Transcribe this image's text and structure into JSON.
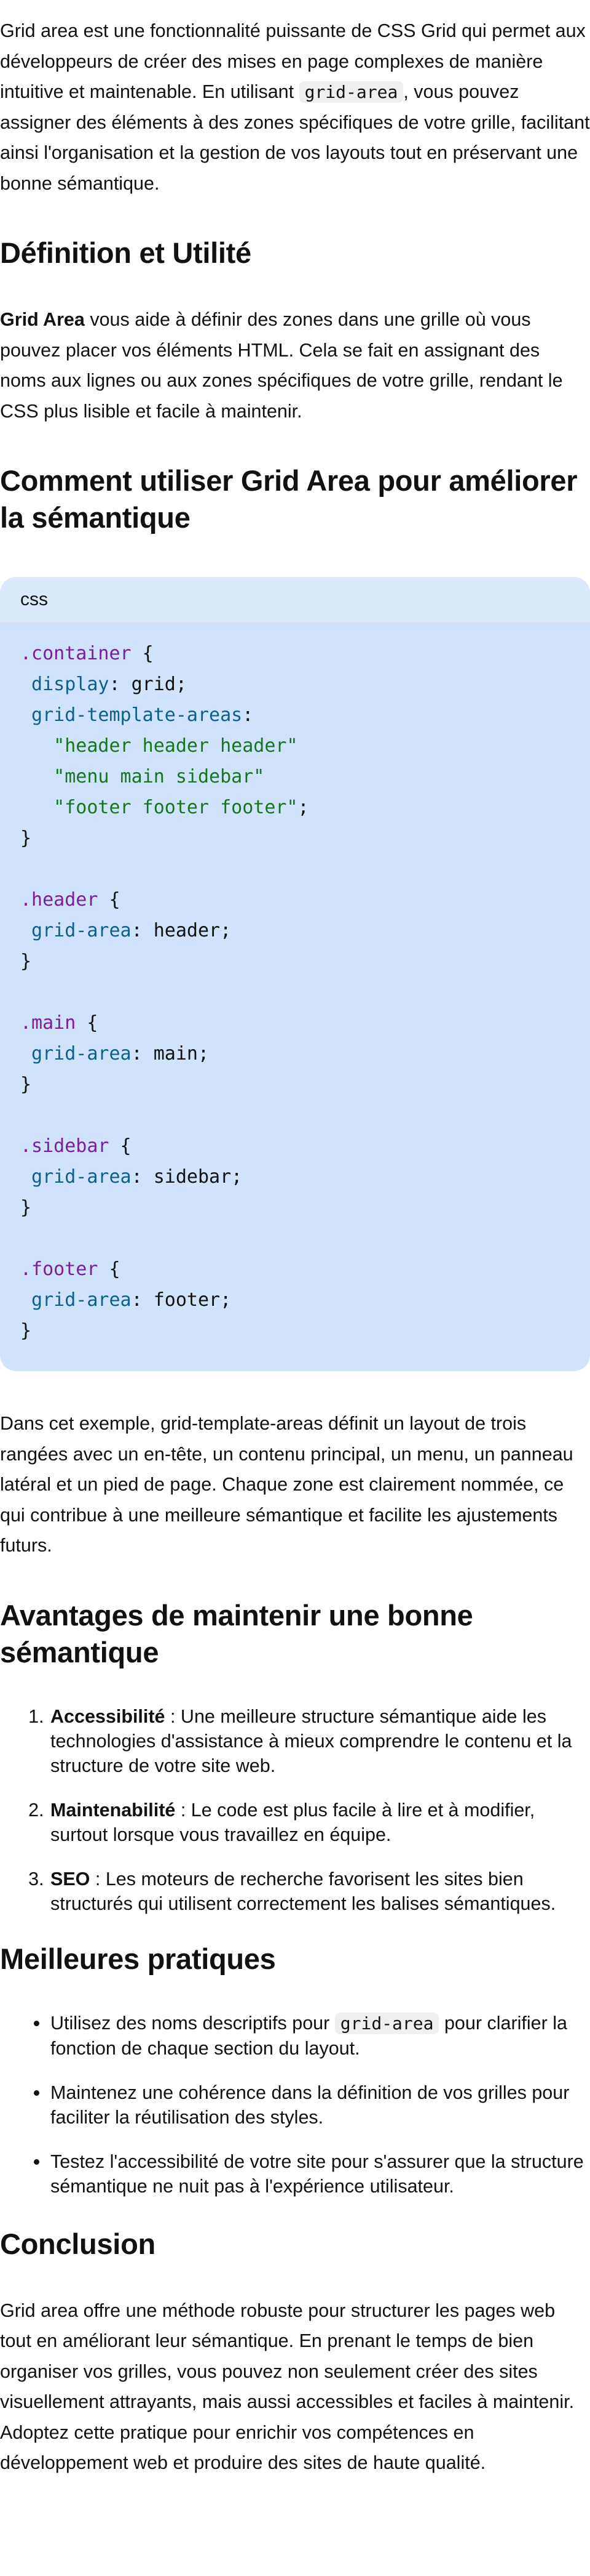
{
  "intro": {
    "before": "Grid area est une fonctionnalité puissante de CSS Grid qui permet aux développeurs de créer des mises en page complexes de manière intuitive et maintenable. En utilisant ",
    "code": "grid-area",
    "after": ", vous pouvez assigner des éléments à des zones spécifiques de votre grille, facilitant ainsi l'organisation et la gestion de vos layouts tout en préservant une bonne sémantique."
  },
  "definition": {
    "heading": "Définition et Utilité",
    "bold": "Grid Area",
    "text": " vous aide à définir des zones dans une grille où vous pouvez placer vos éléments HTML. Cela se fait en assignant des noms aux lignes ou aux zones spécifiques de votre grille, rendant le CSS plus lisible et facile à maintenir."
  },
  "usage": {
    "heading": "Comment utiliser Grid Area pour améliorer la sémantique",
    "code_lang": "css",
    "code_lines": [
      [
        {
          "t": ".container",
          "c": "sel"
        },
        {
          "t": " {",
          "c": "plain"
        }
      ],
      [
        {
          "t": " display",
          "c": "prop"
        },
        {
          "t": ": grid;",
          "c": "plain"
        }
      ],
      [
        {
          "t": " grid-template-areas",
          "c": "prop"
        },
        {
          "t": ":",
          "c": "plain"
        }
      ],
      [
        {
          "t": "   \"header header header\"",
          "c": "str"
        }
      ],
      [
        {
          "t": "   \"menu main sidebar\"",
          "c": "str"
        }
      ],
      [
        {
          "t": "   \"footer footer footer\"",
          "c": "str"
        },
        {
          "t": ";",
          "c": "plain"
        }
      ],
      [
        {
          "t": "}",
          "c": "plain"
        }
      ],
      [
        {
          "t": "",
          "c": "plain"
        }
      ],
      [
        {
          "t": ".header",
          "c": "sel"
        },
        {
          "t": " {",
          "c": "plain"
        }
      ],
      [
        {
          "t": " grid-area",
          "c": "prop"
        },
        {
          "t": ": header;",
          "c": "plain"
        }
      ],
      [
        {
          "t": "}",
          "c": "plain"
        }
      ],
      [
        {
          "t": "",
          "c": "plain"
        }
      ],
      [
        {
          "t": ".main",
          "c": "sel"
        },
        {
          "t": " {",
          "c": "plain"
        }
      ],
      [
        {
          "t": " grid-area",
          "c": "prop"
        },
        {
          "t": ": main;",
          "c": "plain"
        }
      ],
      [
        {
          "t": "}",
          "c": "plain"
        }
      ],
      [
        {
          "t": "",
          "c": "plain"
        }
      ],
      [
        {
          "t": ".sidebar",
          "c": "sel"
        },
        {
          "t": " {",
          "c": "plain"
        }
      ],
      [
        {
          "t": " grid-area",
          "c": "prop"
        },
        {
          "t": ": sidebar;",
          "c": "plain"
        }
      ],
      [
        {
          "t": "}",
          "c": "plain"
        }
      ],
      [
        {
          "t": "",
          "c": "plain"
        }
      ],
      [
        {
          "t": ".footer",
          "c": "sel"
        },
        {
          "t": " {",
          "c": "plain"
        }
      ],
      [
        {
          "t": " grid-area",
          "c": "prop"
        },
        {
          "t": ": footer;",
          "c": "plain"
        }
      ],
      [
        {
          "t": "}",
          "c": "plain"
        }
      ]
    ],
    "explanation": "Dans cet exemple, grid-template-areas définit un layout de trois rangées avec un en-tête, un contenu principal, un menu, un panneau latéral et un pied de page. Chaque zone est clairement nommée, ce qui contribue à une meilleure sémantique et facilite les ajustements futurs."
  },
  "advantages": {
    "heading": "Avantages de maintenir une bonne sémantique",
    "items": [
      {
        "bold": "Accessibilité",
        "text": " : Une meilleure structure sémantique aide les technologies d'assistance à mieux comprendre le contenu et la structure de votre site web."
      },
      {
        "bold": "Maintenabilité",
        "text": " : Le code est plus facile à lire et à modifier, surtout lorsque vous travaillez en équipe."
      },
      {
        "bold": "SEO",
        "text": " : Les moteurs de recherche favorisent les sites bien structurés qui utilisent correctement les balises sémantiques."
      }
    ]
  },
  "practices": {
    "heading": "Meilleures pratiques",
    "item1_before": "Utilisez des noms descriptifs pour ",
    "item1_code": "grid-area",
    "item1_after": " pour clarifier la fonction de chaque section du layout.",
    "item2": "Maintenez une cohérence dans la définition de vos grilles pour faciliter la réutilisation des styles.",
    "item3": "Testez l'accessibilité de votre site pour s'assurer que la structure sémantique ne nuit pas à l'expérience utilisateur."
  },
  "conclusion": {
    "heading": "Conclusion",
    "text": "Grid area offre une méthode robuste pour structurer les pages web tout en améliorant leur sémantique. En prenant le temps de bien organiser vos grilles, vous pouvez non seulement créer des sites visuellement attrayants, mais aussi accessibles et faciles à maintenir. Adoptez cette pratique pour enrichir vos compétences en développement web et produire des sites de haute qualité."
  },
  "colors": {
    "code_bg": "#cfe3fd",
    "code_header_bg": "#dce9fd",
    "selector": "#7a1f99",
    "property": "#0f5f8a",
    "string": "#17741f"
  }
}
